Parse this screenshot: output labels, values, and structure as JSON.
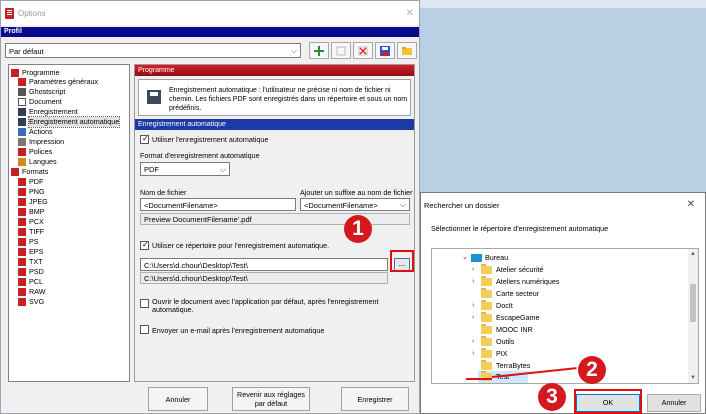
{
  "window": {
    "title": "Options",
    "profile_label": "Profil",
    "profile_value": "Par défaut"
  },
  "tree": {
    "items": [
      {
        "label": "Programme",
        "icon": "program-icon"
      },
      {
        "label": "Paramètres généraux",
        "icon": "settings-icon"
      },
      {
        "label": "Ghostscript",
        "icon": "ghostscript-icon"
      },
      {
        "label": "Document",
        "icon": "document-icon"
      },
      {
        "label": "Enregistrement",
        "icon": "save-icon"
      },
      {
        "label": "Enregistrement automatique",
        "icon": "auto-save-icon"
      },
      {
        "label": "Actions",
        "icon": "actions-icon"
      },
      {
        "label": "Impression",
        "icon": "print-icon"
      },
      {
        "label": "Polices",
        "icon": "fonts-icon"
      },
      {
        "label": "Langues",
        "icon": "languages-icon"
      },
      {
        "label": "Formats",
        "icon": "formats-icon"
      },
      {
        "label": "PDF",
        "icon": "file-icon"
      },
      {
        "label": "PNG",
        "icon": "file-icon"
      },
      {
        "label": "JPEG",
        "icon": "file-icon"
      },
      {
        "label": "BMP",
        "icon": "file-icon"
      },
      {
        "label": "PCX",
        "icon": "file-icon"
      },
      {
        "label": "TIFF",
        "icon": "file-icon"
      },
      {
        "label": "PS",
        "icon": "file-icon"
      },
      {
        "label": "EPS",
        "icon": "file-icon"
      },
      {
        "label": "TXT",
        "icon": "file-icon"
      },
      {
        "label": "PSD",
        "icon": "file-icon"
      },
      {
        "label": "PCL",
        "icon": "file-icon"
      },
      {
        "label": "RAW",
        "icon": "file-icon"
      },
      {
        "label": "SVG",
        "icon": "file-icon"
      }
    ]
  },
  "panel": {
    "programme_header": "Programme",
    "info_text": "Enregistrement automatique : l'utilisateur ne précise ni nom de fichier ni chemin. Les fichiers PDF sont enregistrés dans un répertoire et sous un nom prédéfinis.",
    "section_header": "Enregistrement automatique",
    "use_auto_save": "Utiliser l'enregistrement automatique",
    "format_label": "Format d'enregistrement automatique",
    "format_value": "PDF",
    "filename_label": "Nom de fichier",
    "filename_value": "<DocumentFilename>",
    "suffix_label": "Ajouter un suffixe au nom de fichier",
    "suffix_value": "<DocumentFilename>",
    "preview": "Preview DocumentFilename'.pdf",
    "use_dir": "Utiliser ce répertoire pour l'enregistrement automatique.",
    "dir_value": "C:\\Users\\d.chour\\Desktop\\Test\\",
    "dir_readout": "C:\\Users\\d.chour\\Desktop\\Test\\",
    "browse_label": "...",
    "open_doc": "Ouvrir le document avec l'application par défaut, après l'enregistrement automatique.",
    "send_email": "Envoyer un e-mail après l'enregistrement automatique"
  },
  "buttons": {
    "cancel": "Annuler",
    "reset_line1": "Revenir aux réglages",
    "reset_line2": "par défaut",
    "save": "Enregistrer"
  },
  "dialog": {
    "title": "Rechercher un dossier",
    "instruction": "Sélectionner le répertoire d'enregistrement automatique",
    "folders": [
      {
        "label": "Bureau",
        "icon": "desktop-icon",
        "chevron": "v"
      },
      {
        "label": "Atelier sécurité",
        "icon": "folder-icon",
        "chevron": ">"
      },
      {
        "label": "Ateliers numériques",
        "icon": "folder-icon",
        "chevron": ">"
      },
      {
        "label": "Carte secteur",
        "icon": "folder-icon",
        "chevron": ""
      },
      {
        "label": "DocIt",
        "icon": "folder-icon",
        "chevron": ">"
      },
      {
        "label": "EscapeGame",
        "icon": "folder-icon",
        "chevron": ">"
      },
      {
        "label": "MOOC INR",
        "icon": "folder-icon",
        "chevron": ""
      },
      {
        "label": "Outils",
        "icon": "folder-icon",
        "chevron": ">"
      },
      {
        "label": "PIX",
        "icon": "folder-icon",
        "chevron": ">"
      },
      {
        "label": "TerraBytes",
        "icon": "folder-icon",
        "chevron": ""
      },
      {
        "label": "Test",
        "icon": "folder-icon",
        "chevron": ""
      }
    ],
    "ok": "OK",
    "cancel": "Annuler"
  },
  "badges": {
    "one": "1",
    "two": "2",
    "three": "3"
  },
  "colors": {
    "annotation_red": "#e01010",
    "profile_bar": "#0a0a8c",
    "section_blue": "#1a3aa8"
  }
}
